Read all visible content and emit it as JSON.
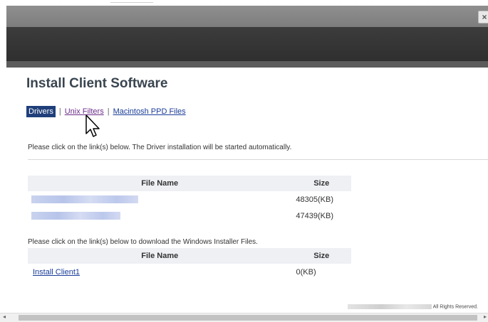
{
  "dialog": {
    "close_label": "×"
  },
  "page": {
    "title": "Install Client Software",
    "tabs": [
      {
        "label": "Drivers",
        "active": true
      },
      {
        "label": "Unix Filters",
        "active": false
      },
      {
        "label": "Macintosh PPD Files",
        "active": false
      }
    ],
    "separator": "|"
  },
  "drivers": {
    "note": "Please click on the link(s) below. The Driver installation will be started automatically.",
    "columns": {
      "name": "File Name",
      "size": "Size"
    },
    "rows": [
      {
        "name": "",
        "size": "48305(KB)"
      },
      {
        "name": "",
        "size": "47439(KB)"
      }
    ]
  },
  "installer": {
    "note": "Please click on the link(s) below to download the Windows Installer Files.",
    "columns": {
      "name": "File Name",
      "size": "Size"
    },
    "rows": [
      {
        "name": "Install Client1",
        "size": "0(KB)"
      }
    ]
  },
  "footer": {
    "text": "All Rights Reserved."
  },
  "colors": {
    "accent": "#1f3f7a",
    "link": "#1a3c99",
    "header_band": "#333333"
  }
}
